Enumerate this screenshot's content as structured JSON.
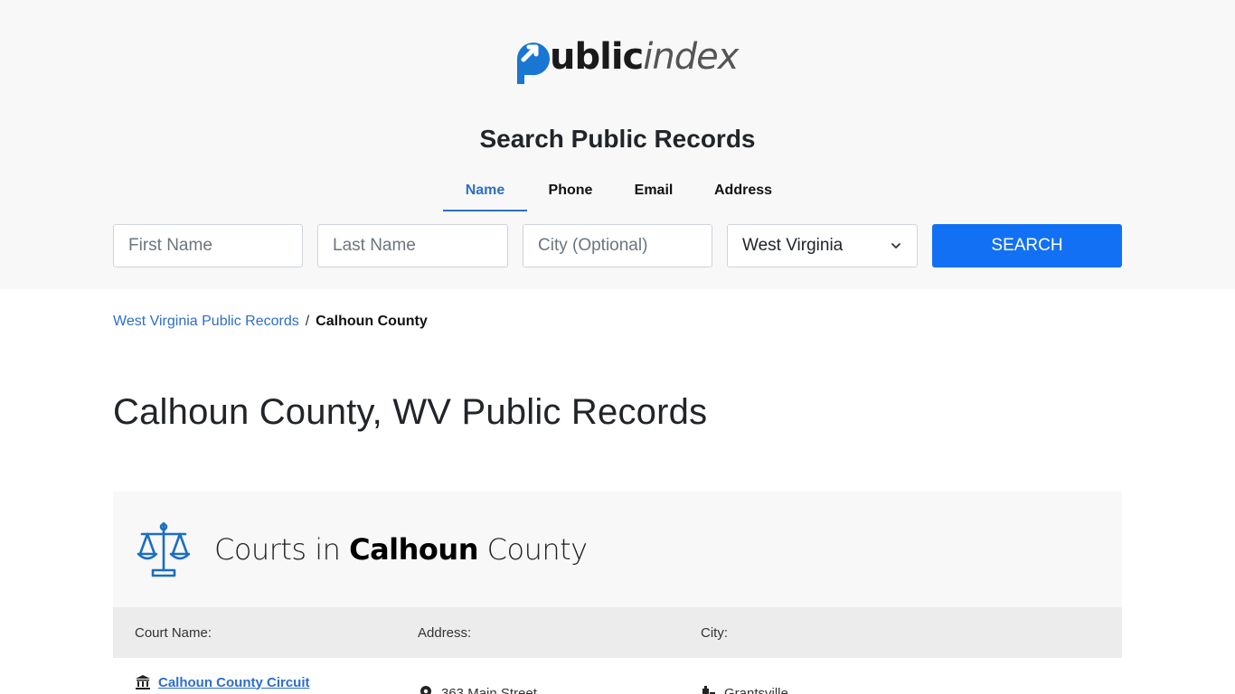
{
  "logo": {
    "text_bold": "ublic",
    "text_light": "index",
    "mark": "p-arrow-logo-icon"
  },
  "search": {
    "title": "Search Public Records",
    "tabs": [
      {
        "label": "Name",
        "active": true
      },
      {
        "label": "Phone",
        "active": false
      },
      {
        "label": "Email",
        "active": false
      },
      {
        "label": "Address",
        "active": false
      }
    ],
    "first_name_placeholder": "First Name",
    "last_name_placeholder": "Last Name",
    "city_placeholder": "City (Optional)",
    "state_value": "West Virginia",
    "button_label": "SEARCH"
  },
  "breadcrumb": {
    "parent": "West Virginia Public Records",
    "separator": "/",
    "current": "Calhoun County"
  },
  "page": {
    "title": "Calhoun County, WV Public Records"
  },
  "courts": {
    "title_prefix": "Courts in ",
    "title_county": "Calhoun",
    "title_suffix": " County",
    "icon": "scales-of-justice-icon",
    "columns": [
      "Court Name:",
      "Address:",
      "City:"
    ],
    "rows": [
      {
        "name": "Calhoun County Circuit",
        "address": "363 Main Street",
        "city": "Grantsville"
      }
    ]
  },
  "colors": {
    "accent": "#2d6ec8",
    "button": "#1270f5",
    "header_bg": "#f8f8f8"
  }
}
